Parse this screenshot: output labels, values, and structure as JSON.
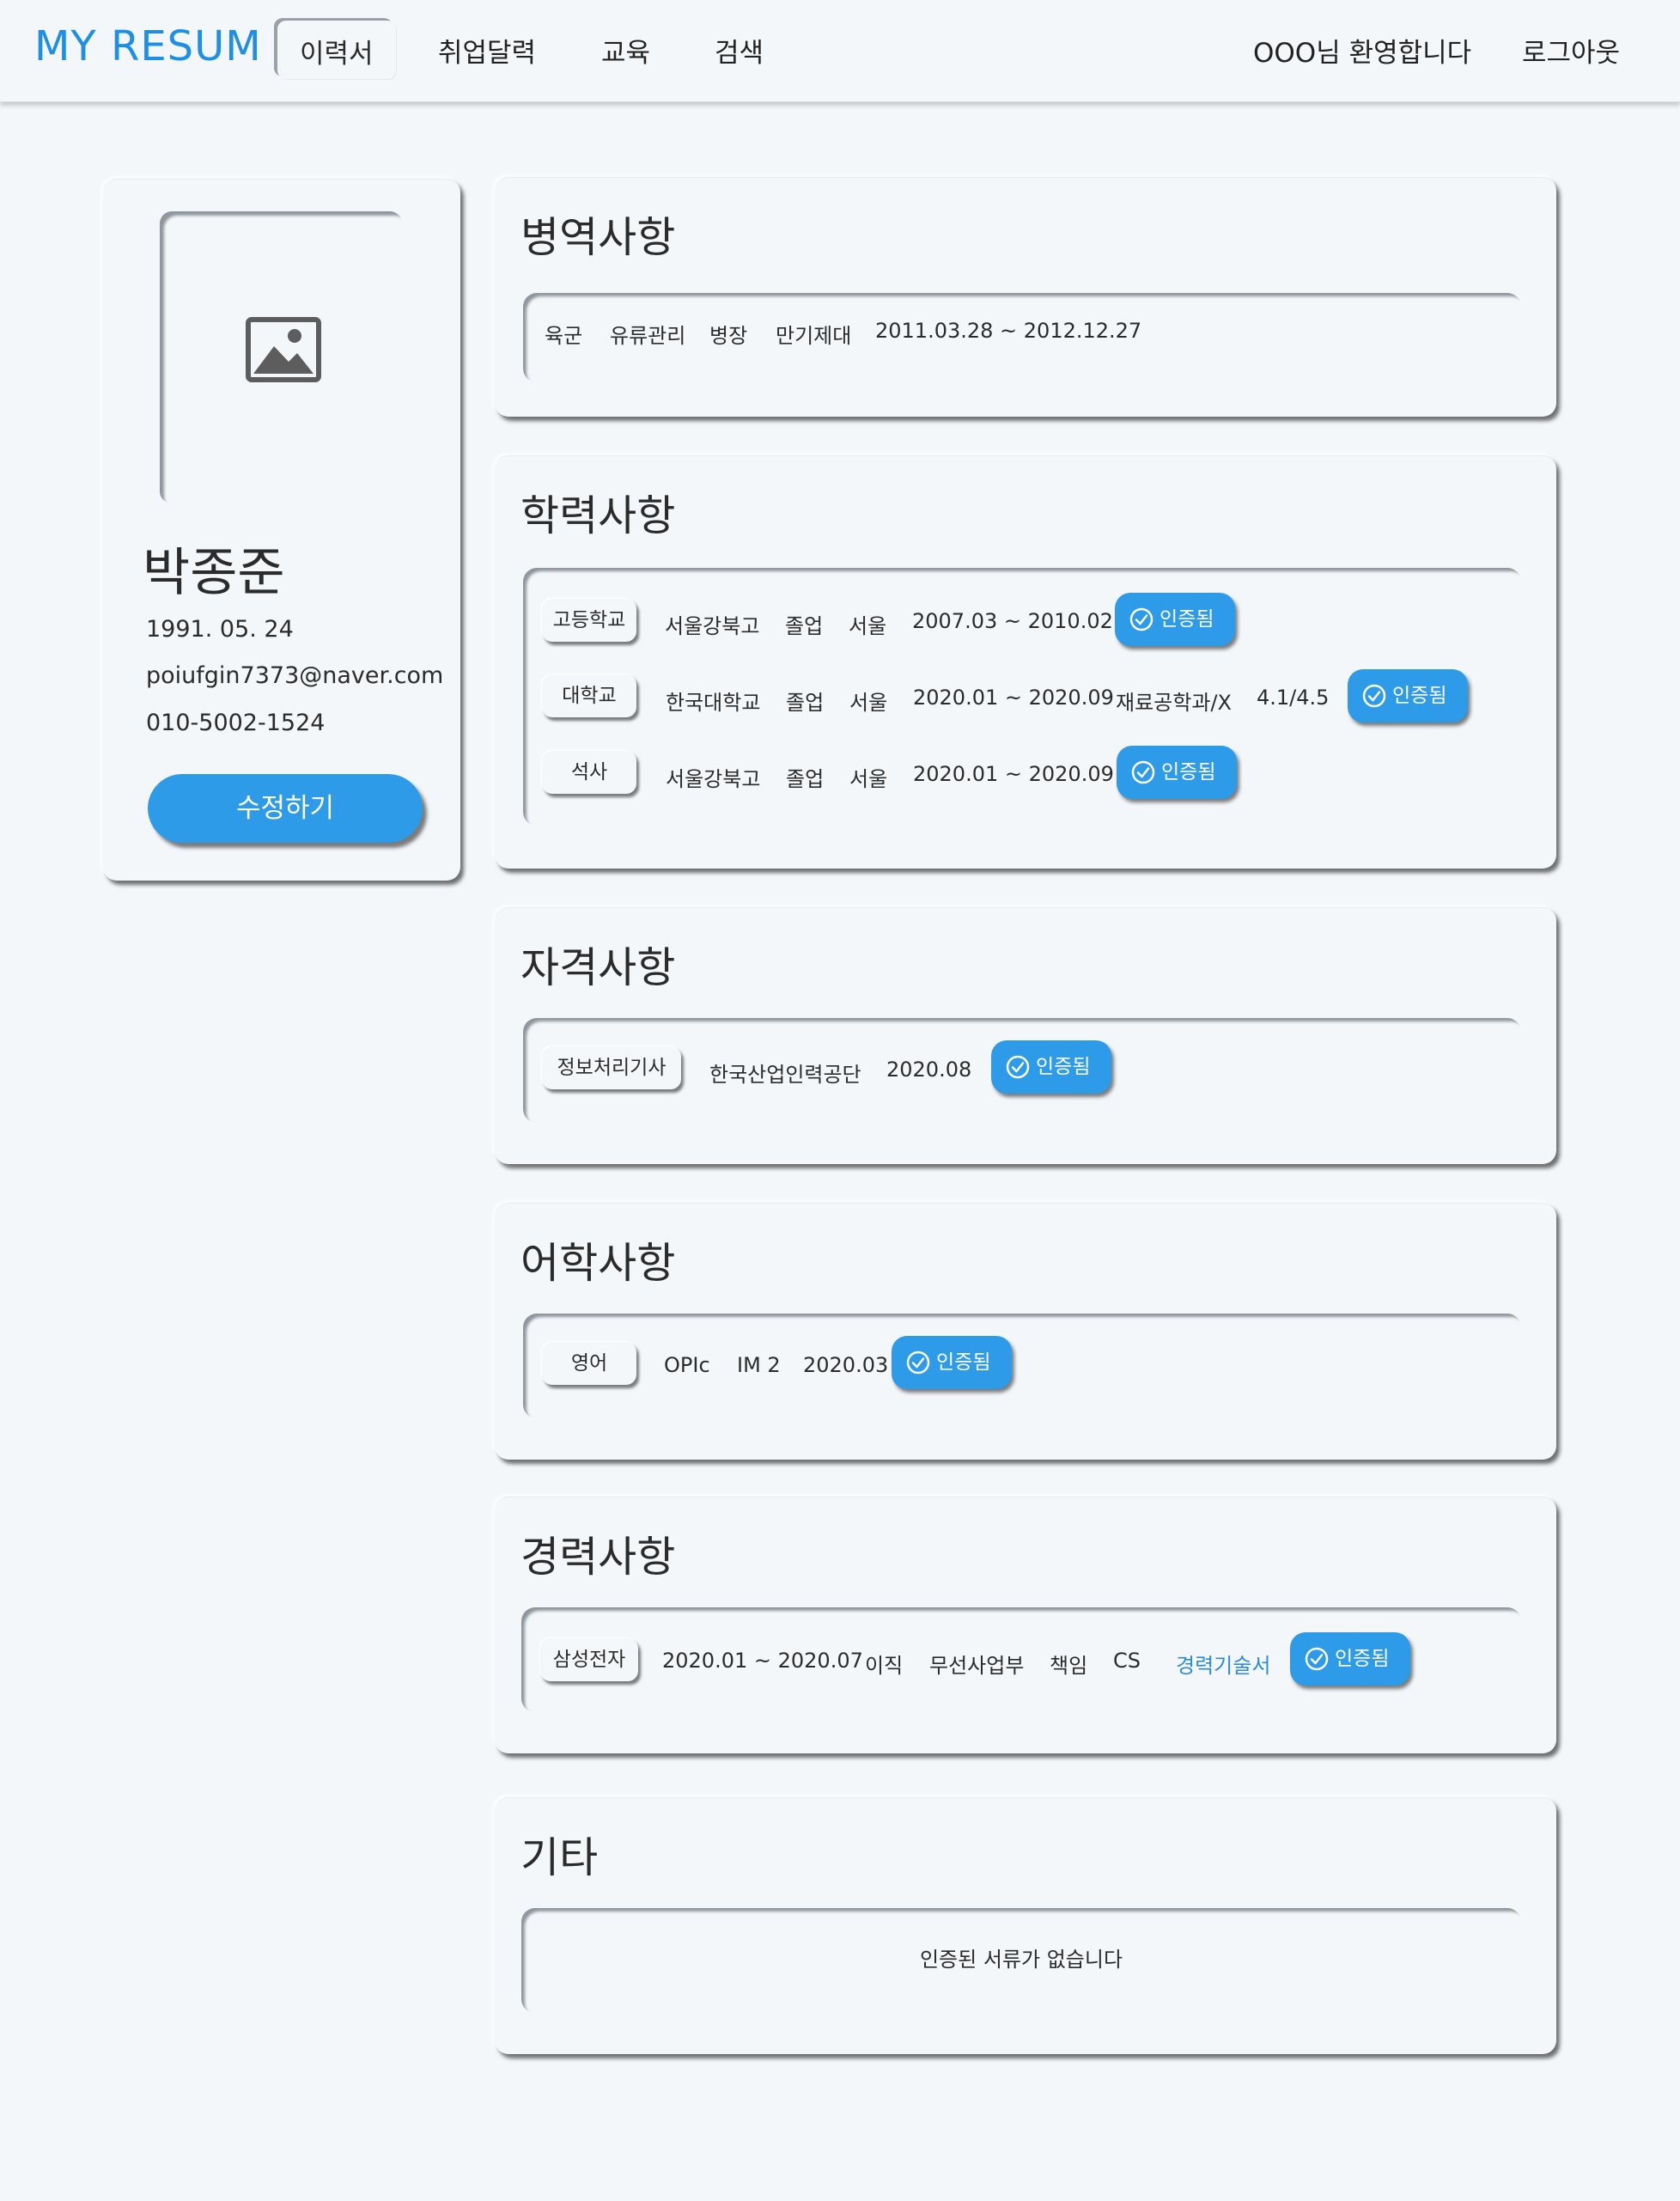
{
  "header": {
    "logo": "MY RESUM",
    "nav": [
      "이력서",
      "취업달력",
      "교육",
      "검색"
    ],
    "active_nav": "이력서",
    "welcome": "OOO님 환영합니다",
    "logout": "로그아웃"
  },
  "profile": {
    "photo_icon": "image-icon",
    "name": "박종준",
    "birth": "1991. 05. 24",
    "email": "poiufgin7373@naver.com",
    "phone": "010-5002-1524",
    "edit_label": "수정하기"
  },
  "verified_label": "인증됨",
  "sections": {
    "military": {
      "title": "병역사항",
      "fields": [
        "육군",
        "유류관리",
        "병장",
        "만기제대",
        "2011.03.28 ~ 2012.12.27"
      ]
    },
    "education": {
      "title": "학력사항",
      "rows": [
        {
          "type": "고등학교",
          "school": "서울강북고",
          "status": "졸업",
          "region": "서울",
          "period": "2007.03 ~ 2010.02"
        },
        {
          "type": "대학교",
          "school": "한국대학교",
          "status": "졸업",
          "region": "서울",
          "period": "2020.01 ~ 2020.09",
          "major": "재료공학과/X",
          "gpa": "4.1/4.5"
        },
        {
          "type": "석사",
          "school": "서울강북고",
          "status": "졸업",
          "region": "서울",
          "period": "2020.01 ~ 2020.09"
        }
      ]
    },
    "certificates": {
      "title": "자격사항",
      "rows": [
        {
          "name": "정보처리기사",
          "issuer": "한국산업인력공단",
          "date": "2020.08"
        }
      ]
    },
    "languages": {
      "title": "어학사항",
      "rows": [
        {
          "language": "영어",
          "test": "OPIc",
          "score": "IM 2",
          "date": "2020.03"
        }
      ]
    },
    "career": {
      "title": "경력사항",
      "rows": [
        {
          "company": "삼성전자",
          "period": "2020.01 ~ 2020.07",
          "status": "이직",
          "department": "무선사업부",
          "position": "책임",
          "role": "CS",
          "doc_link": "경력기술서"
        }
      ]
    },
    "etc": {
      "title": "기타",
      "empty_message": "인증된 서류가 없습니다"
    }
  },
  "colors": {
    "accent": "#2e9be9",
    "logo": "#1e8fe6",
    "background": "#f4f7fa",
    "link": "#2d8bd1"
  }
}
